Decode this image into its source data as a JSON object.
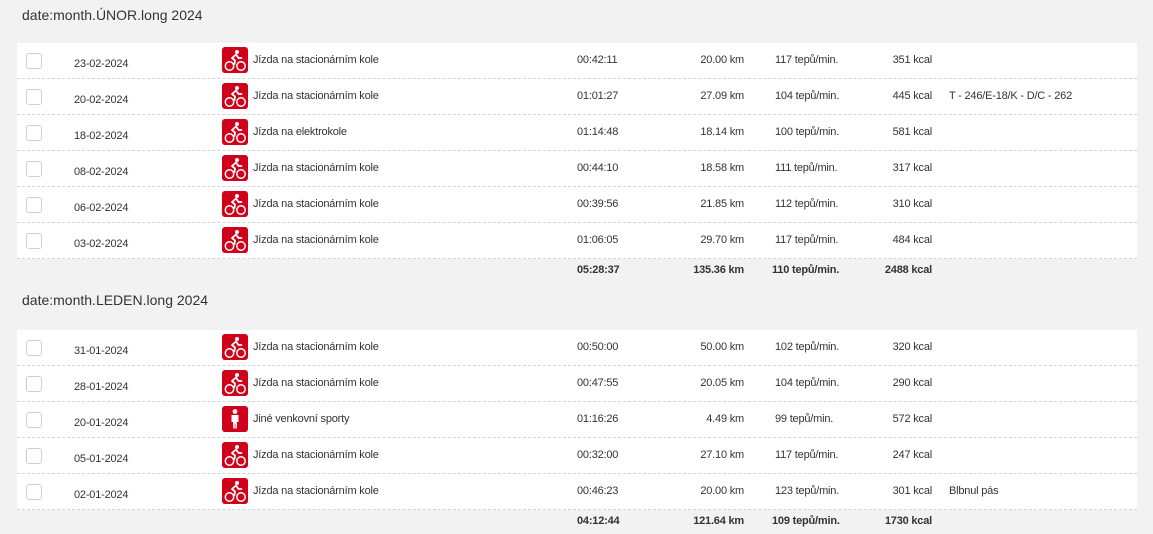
{
  "sections": [
    {
      "title": "date:month.ÚNOR.long 2024",
      "rows": [
        {
          "date": "23-02-2024",
          "icon": "bike-icon",
          "activity": "Jízda na stacionárním kole",
          "duration": "00:42:11",
          "distance": "20.00 km",
          "heart_rate": "117 tepů/min.",
          "kcal": "351 kcal",
          "note": ""
        },
        {
          "date": "20-02-2024",
          "icon": "bike-icon",
          "activity": "Jízda na stacionárním kole",
          "duration": "01:01:27",
          "distance": "27.09 km",
          "heart_rate": "104 tepů/min.",
          "kcal": "445 kcal",
          "note": "T - 246/E-18/K - D/C - 262"
        },
        {
          "date": "18-02-2024",
          "icon": "bike-icon",
          "activity": "Jízda na elektrokole",
          "duration": "01:14:48",
          "distance": "18.14 km",
          "heart_rate": "100 tepů/min.",
          "kcal": "581 kcal",
          "note": ""
        },
        {
          "date": "08-02-2024",
          "icon": "bike-icon",
          "activity": "Jízda na stacionárním kole",
          "duration": "00:44:10",
          "distance": "18.58 km",
          "heart_rate": "111 tepů/min.",
          "kcal": "317 kcal",
          "note": ""
        },
        {
          "date": "06-02-2024",
          "icon": "bike-icon",
          "activity": "Jízda na stacionárním kole",
          "duration": "00:39:56",
          "distance": "21.85 km",
          "heart_rate": "112 tepů/min.",
          "kcal": "310 kcal",
          "note": ""
        },
        {
          "date": "03-02-2024",
          "icon": "bike-icon",
          "activity": "Jízda na stacionárním kole",
          "duration": "01:06:05",
          "distance": "29.70 km",
          "heart_rate": "117 tepů/min.",
          "kcal": "484 kcal",
          "note": ""
        }
      ],
      "totals": {
        "duration": "05:28:37",
        "distance": "135.36 km",
        "heart_rate": "110 tepů/min.",
        "kcal": "2488 kcal"
      }
    },
    {
      "title": "date:month.LEDEN.long 2024",
      "rows": [
        {
          "date": "31-01-2024",
          "icon": "bike-icon",
          "activity": "Jízda na stacionárním kole",
          "duration": "00:50:00",
          "distance": "50.00 km",
          "heart_rate": "102 tepů/min.",
          "kcal": "320 kcal",
          "note": ""
        },
        {
          "date": "28-01-2024",
          "icon": "bike-icon",
          "activity": "Jízda na stacionárním kole",
          "duration": "00:47:55",
          "distance": "20.05 km",
          "heart_rate": "104 tepů/min.",
          "kcal": "290 kcal",
          "note": ""
        },
        {
          "date": "20-01-2024",
          "icon": "person-icon",
          "activity": "Jiné venkovní sporty",
          "duration": "01:16:26",
          "distance": "4.49 km",
          "heart_rate": "99 tepů/min.",
          "kcal": "572 kcal",
          "note": ""
        },
        {
          "date": "05-01-2024",
          "icon": "bike-icon",
          "activity": "Jízda na stacionárním kole",
          "duration": "00:32:00",
          "distance": "27.10 km",
          "heart_rate": "117 tepů/min.",
          "kcal": "247 kcal",
          "note": ""
        },
        {
          "date": "02-01-2024",
          "icon": "bike-icon",
          "activity": "Jízda na stacionárním kole",
          "duration": "00:46:23",
          "distance": "20.00 km",
          "heart_rate": "123 tepů/min.",
          "kcal": "301 kcal",
          "note": "Blbnul pás"
        }
      ],
      "totals": {
        "duration": "04:12:44",
        "distance": "121.64 km",
        "heart_rate": "109 tepů/min.",
        "kcal": "1730 kcal"
      }
    }
  ],
  "colors": {
    "icon_bg": "#d0011b",
    "page_bg": "#f2f2f2",
    "row_bg": "#ffffff"
  }
}
